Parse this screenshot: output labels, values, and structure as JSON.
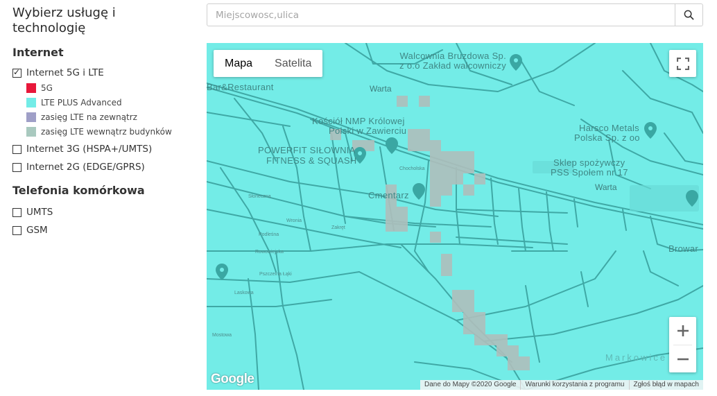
{
  "sidebar": {
    "heading": "Wybierz usługę i technologię",
    "internet_title": "Internet",
    "options_internet": [
      {
        "label": "Internet 5G i LTE",
        "checked": true
      },
      {
        "label": "Internet 3G (HSPA+/UMTS)",
        "checked": false
      },
      {
        "label": "Internet 2G (EDGE/GPRS)",
        "checked": false
      }
    ],
    "legend": [
      {
        "label": "5G",
        "color": "#e8173a"
      },
      {
        "label": "LTE PLUS Advanced",
        "color": "#73ece7"
      },
      {
        "label": "zasięg LTE na zewnątrz",
        "color": "#9f9fc7"
      },
      {
        "label": "zasięg LTE wewnątrz budynków",
        "color": "#a9c9bf"
      }
    ],
    "telefonia_title": "Telefonia komórkowa",
    "options_telefonia": [
      {
        "label": "UMTS",
        "checked": false
      },
      {
        "label": "GSM",
        "checked": false
      }
    ]
  },
  "search": {
    "placeholder": "Miejscowosc,ulica",
    "value": ""
  },
  "map": {
    "type_tabs": [
      "Mapa",
      "Satelita"
    ],
    "active_tab": "Mapa",
    "logo": "Google",
    "attribution": [
      "Dane do Mapy ©2020 Google",
      "Warunki korzystania z programu",
      "Zgłoś błąd w mapach"
    ],
    "labels": {
      "walcownia": "Walcownia Bruzdowa Sp.",
      "walcownia2": "z o.o Zakład walcowniczy",
      "bar": "Bar&Restaurant",
      "warta1": "Warta",
      "kosciol": "Kościół NMP Królowej",
      "kosciol2": "Polski w Zawierciu",
      "harsco": "Harsco Metals",
      "harsco2": "Polska Sp. z oo",
      "powerfit": "POWERFIT SIŁOWNIA",
      "powerfit2": "FITNESS & SQUASH",
      "sklep": "Sklep spożywczy",
      "sklep2": "PSS Społem nr 17",
      "warta2": "Warta",
      "cmentarz": "Cmentarz",
      "browar": "Browar",
      "markowice": "Markowice",
      "podlesna": "Podleśna",
      "rowowiejska": "Rowowiejska",
      "pszczelna": "Pszczelna Łąki",
      "laskowa": "Laskowa",
      "chocholska": "Chocholska",
      "mostowa": "Mostowa",
      "wronia": "Wronia",
      "zakret": "Zakręt",
      "sloneczna": "Słoneczna"
    },
    "colors": {
      "lte_plus": "#73ece7",
      "indoor": "#aebfbc",
      "road": "#3fa8a5"
    }
  }
}
